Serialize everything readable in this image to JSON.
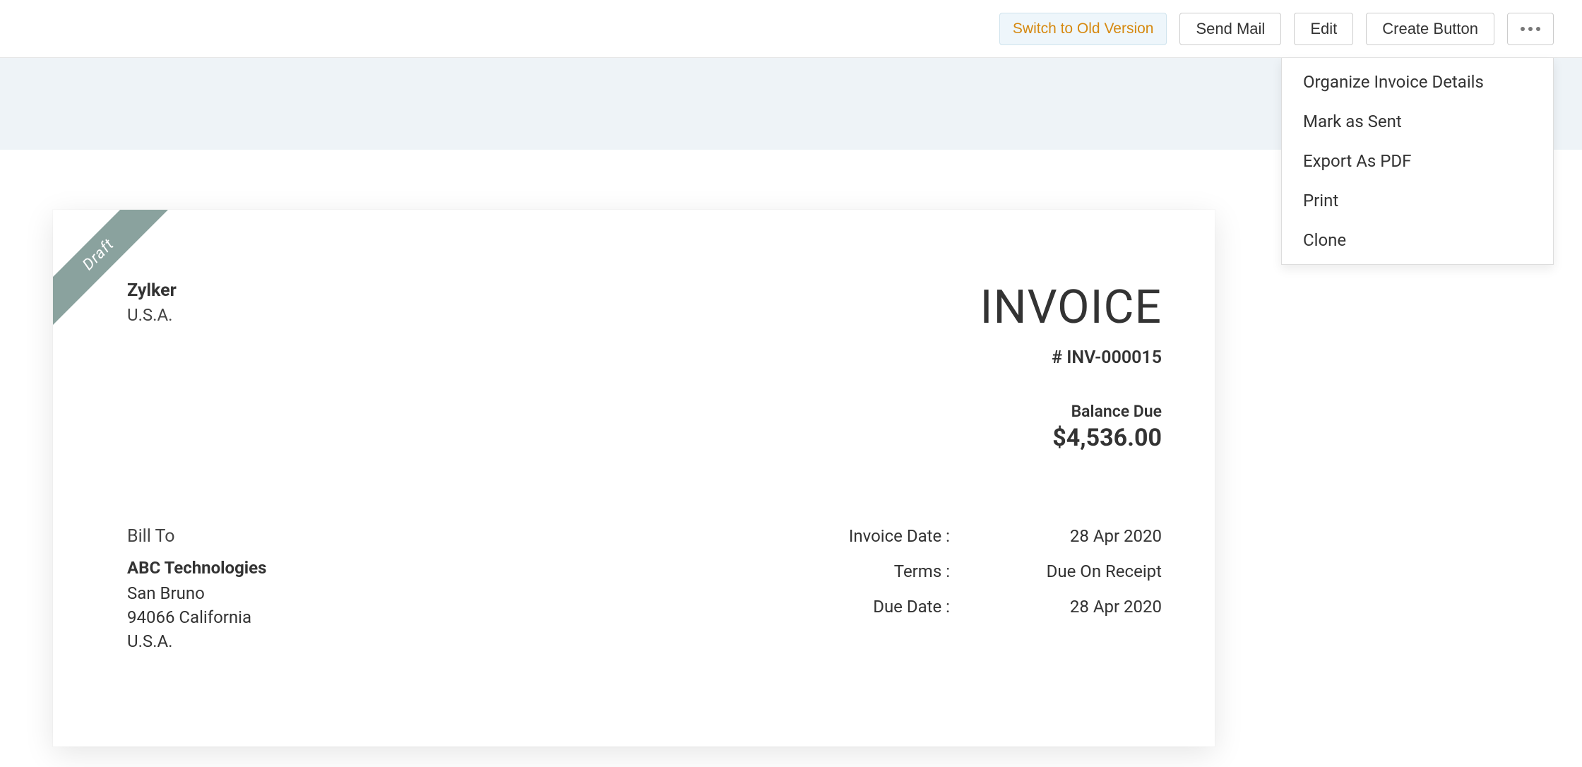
{
  "toolbar": {
    "switch_old": "Switch to Old Version",
    "send_mail": "Send Mail",
    "edit": "Edit",
    "create_button": "Create Button"
  },
  "more_menu": {
    "organize": "Organize Invoice Details",
    "mark_sent": "Mark as Sent",
    "export_pdf": "Export As PDF",
    "print": "Print",
    "clone": "Clone"
  },
  "ribbon": {
    "label": "Draft"
  },
  "company": {
    "name": "Zylker",
    "country": "U.S.A."
  },
  "document": {
    "title": "INVOICE",
    "number": "# INV-000015",
    "balance_label": "Balance Due",
    "balance_amount": "$4,536.00"
  },
  "billto": {
    "heading": "Bill To",
    "name": "ABC Technologies",
    "city": "San Bruno",
    "region": "94066 California",
    "country": "U.S.A."
  },
  "meta": {
    "invoice_date_label": "Invoice Date :",
    "invoice_date_value": "28 Apr 2020",
    "terms_label": "Terms :",
    "terms_value": "Due On Receipt",
    "due_date_label": "Due Date :",
    "due_date_value": "28 Apr 2020"
  }
}
